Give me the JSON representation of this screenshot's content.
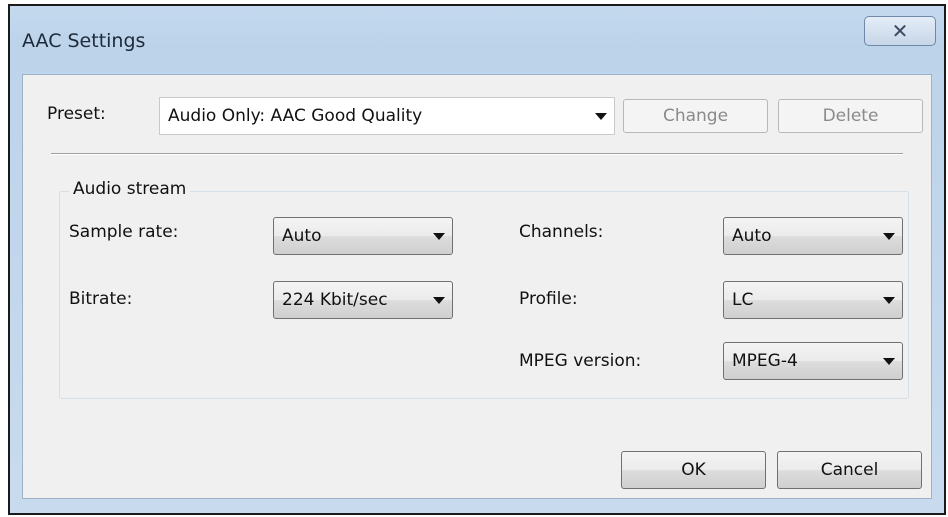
{
  "window": {
    "title": "AAC Settings",
    "close_glyph": "✕"
  },
  "preset": {
    "label": "Preset:",
    "selected": "Audio Only: AAC Good Quality",
    "change_label": "Change",
    "delete_label": "Delete"
  },
  "audio_stream": {
    "group_title": "Audio stream",
    "sample_rate": {
      "label": "Sample rate:",
      "value": "Auto"
    },
    "bitrate": {
      "label": "Bitrate:",
      "value": "224 Kbit/sec"
    },
    "channels": {
      "label": "Channels:",
      "value": "Auto"
    },
    "profile": {
      "label": "Profile:",
      "value": "LC"
    },
    "mpeg_version": {
      "label": "MPEG version:",
      "value": "MPEG-4"
    }
  },
  "footer": {
    "ok_label": "OK",
    "cancel_label": "Cancel"
  }
}
